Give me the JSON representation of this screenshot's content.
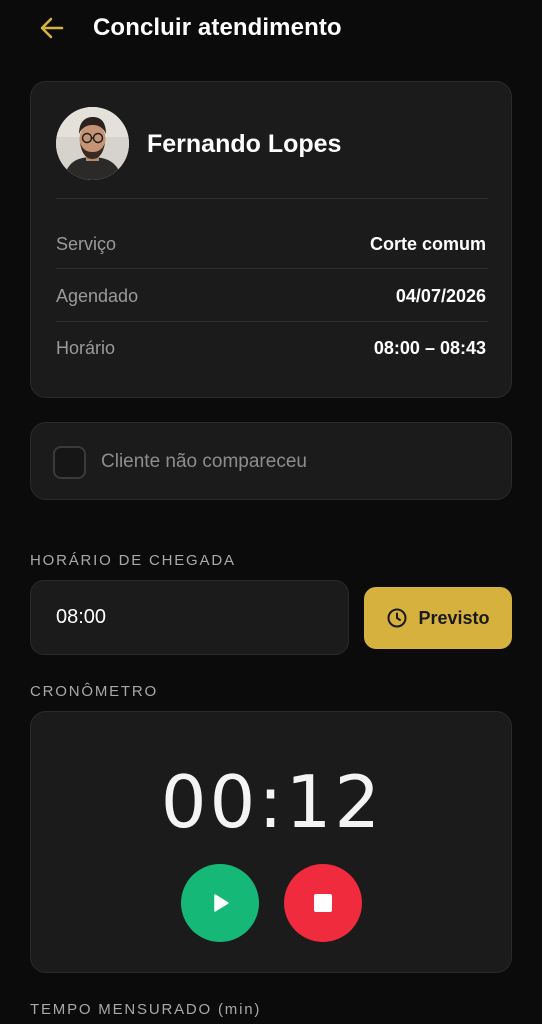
{
  "header": {
    "back_icon": "arrow-left-icon",
    "title": "Concluir atendimento",
    "accent_color": "#d7b13e"
  },
  "client": {
    "name": "Fernando Lopes",
    "avatar_icon": "user-photo",
    "rows": [
      {
        "label": "Serviço",
        "value": "Corte comum"
      },
      {
        "label": "Agendado",
        "value": "04/07/2026"
      },
      {
        "label": "Horário",
        "value": "08:00 – 08:43"
      }
    ]
  },
  "no_show": {
    "label": "Cliente não compareceu",
    "checked": false
  },
  "arrival": {
    "section_label": "HORÁRIO DE CHEGADA",
    "value": "08:00",
    "button_label": "Previsto",
    "button_icon": "clock-icon"
  },
  "timer": {
    "section_label": "CRONÔMETRO",
    "display": "00:12",
    "play_icon": "play-icon",
    "stop_icon": "stop-icon",
    "play_color": "#16b877",
    "stop_color": "#ef2b3d"
  },
  "measured": {
    "section_label": "TEMPO MENSURADO (min)"
  }
}
